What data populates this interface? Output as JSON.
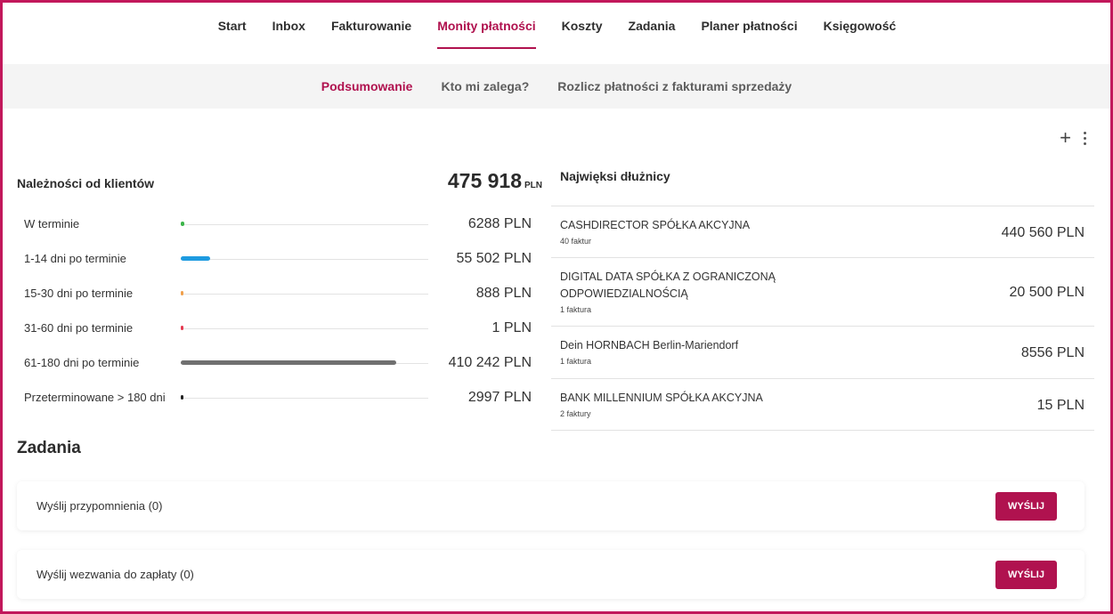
{
  "nav": {
    "items": [
      {
        "label": "Start"
      },
      {
        "label": "Inbox"
      },
      {
        "label": "Fakturowanie"
      },
      {
        "label": "Monity płatności",
        "active": true
      },
      {
        "label": "Koszty"
      },
      {
        "label": "Zadania"
      },
      {
        "label": "Planer płatności"
      },
      {
        "label": "Księgowość"
      }
    ]
  },
  "subnav": {
    "items": [
      {
        "label": "Podsumowanie",
        "active": true
      },
      {
        "label": "Kto mi zalega?"
      },
      {
        "label": "Rozlicz płatności z fakturami sprzedaży"
      }
    ]
  },
  "toolbar": {
    "plus_icon": "plus-icon",
    "more_icon": "more-vertical-icon"
  },
  "receivables": {
    "title": "Należności od klientów",
    "total": "475 918",
    "total_currency": "PLN",
    "rows": [
      {
        "label": "W terminie",
        "value": "6288 PLN",
        "color": "#3cb54a",
        "fill": 0.015
      },
      {
        "label": "1-14 dni po terminie",
        "value": "55 502 PLN",
        "color": "#1e9be0",
        "fill": 0.119
      },
      {
        "label": "15-30 dni po terminie",
        "value": "888 PLN",
        "color": "#f0a04b",
        "fill": 0.005
      },
      {
        "label": "31-60 dni po terminie",
        "value": "1 PLN",
        "color": "#e53950",
        "fill": 0.005
      },
      {
        "label": "61-180 dni po terminie",
        "value": "410 242 PLN",
        "color": "#707070",
        "fill": 0.87
      },
      {
        "label": "Przeterminowane > 180 dni",
        "value": "2997 PLN",
        "color": "#222222",
        "fill": 0.007
      }
    ]
  },
  "debtors": {
    "title": "Najwięksi dłużnicy",
    "rows": [
      {
        "name": "CASHDIRECTOR SPÓŁKA AKCYJNA",
        "count": "40 faktur",
        "amount": "440 560 PLN"
      },
      {
        "name": "DIGITAL DATA SPÓŁKA Z OGRANICZONĄ ODPOWIEDZIALNOŚCIĄ",
        "count": "1 faktura",
        "amount": "20 500 PLN"
      },
      {
        "name": "Dein HORNBACH Berlin-Mariendorf",
        "count": "1 faktura",
        "amount": "8556 PLN"
      },
      {
        "name": "BANK MILLENNIUM SPÓŁKA AKCYJNA",
        "count": "2 faktury",
        "amount": "15 PLN"
      }
    ]
  },
  "tasks": {
    "title": "Zadania",
    "items": [
      {
        "label": "Wyślij przypomnienia (0)",
        "button": "WYŚLIJ"
      },
      {
        "label": "Wyślij wezwania do zapłaty (0)",
        "button": "WYŚLIJ"
      }
    ]
  },
  "colors": {
    "accent": "#b0124f",
    "frame": "#c2185b"
  }
}
